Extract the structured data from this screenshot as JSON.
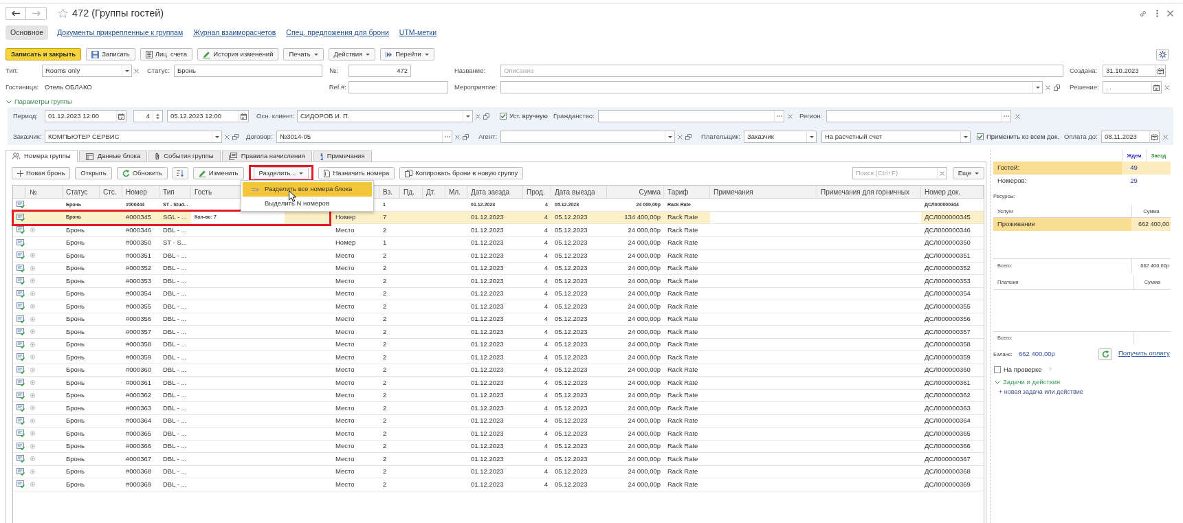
{
  "window": {
    "title": "472 (Группы гостей)",
    "favorite": false
  },
  "nav_buttons": [
    {
      "disabled": false
    },
    {
      "disabled": true
    }
  ],
  "section_tabs": [
    {
      "label": "Основное",
      "selected": true
    },
    {
      "label": "Документы прикрепленные к группам",
      "selected": false
    },
    {
      "label": "Журнал взаиморасчетов",
      "selected": false
    },
    {
      "label": "Спец. предложения для брони",
      "selected": false
    },
    {
      "label": "UTM-метки",
      "selected": false
    }
  ],
  "toolbar": [
    {
      "label": "Записать и закрыть",
      "kind": "primary",
      "menu": false
    },
    {
      "label": "Записать",
      "kind": "plain",
      "menu": false
    },
    {
      "label": "Лиц. счета",
      "kind": "plain",
      "menu": false
    },
    {
      "label": "История изменений",
      "kind": "plain",
      "menu": false
    },
    {
      "label": "Печать",
      "kind": "plain",
      "menu": true
    },
    {
      "label": "Действия",
      "kind": "plain",
      "menu": true
    },
    {
      "label": "Перейти",
      "kind": "plain",
      "menu": true
    }
  ],
  "header": {
    "type": {
      "label": "Тип:",
      "value": "Rooms only"
    },
    "status": {
      "label": "Статус:",
      "value": "Бронь"
    },
    "number": {
      "label": "№:",
      "value": "472"
    },
    "name": {
      "label": "Название:",
      "placeholder": "Описание"
    },
    "created": {
      "label": "Создана:",
      "value": "31.10.2023"
    },
    "hotel": {
      "label": "Гостиница:",
      "value": "Отель ОБЛАКО"
    },
    "ref": {
      "label": "Ref.#:"
    },
    "event": {
      "label": "Мероприятие:"
    },
    "decision": {
      "label": "Решение:",
      "value": ". ."
    }
  },
  "group_params": {
    "title": "Параметры группы",
    "expanded": true,
    "period": {
      "label": "Период:",
      "start": "01.12.2023 12:00",
      "nights": "4",
      "end": "05.12.2023 12:00"
    },
    "main_client": {
      "label": "Осн. клиент:",
      "value": "СИДОРОВ И. П."
    },
    "manual": {
      "label": "Уст. вручную",
      "checked": true
    },
    "citizenship": {
      "label": "Гражданство:"
    },
    "region": {
      "label": "Регион:"
    },
    "customer": {
      "label": "Заказчик:",
      "value": "КОМПЬЮТЕР СЕРВИС"
    },
    "contract": {
      "label": "Договор:",
      "value": "№3014-05"
    },
    "agent": {
      "label": "Агент:"
    },
    "payer": {
      "label": "Плательщик:",
      "value": "Заказчик"
    },
    "payment_method": {
      "value": "На расчетный счет"
    },
    "apply_all": {
      "label": "Применить ко всем док.",
      "checked": true
    },
    "pay_by": {
      "label": "Оплата до:",
      "value": "08.11.2023"
    }
  },
  "content_tabs": [
    {
      "label": "Номера группы",
      "selected": true
    },
    {
      "label": "Данные блока",
      "selected": false
    },
    {
      "label": "События группы",
      "selected": false
    },
    {
      "label": "Правила начисления",
      "selected": false
    },
    {
      "label": "Примечания",
      "selected": false
    }
  ],
  "table_toolbar": [
    {
      "label": "Новая бронь",
      "kind": "text",
      "menu": false,
      "framed": false
    },
    {
      "label": "Открыть",
      "kind": "text",
      "menu": false,
      "framed": false
    },
    {
      "label": "Обновить",
      "kind": "text",
      "menu": false,
      "framed": false
    },
    {
      "kind": "icon",
      "menu": false,
      "framed": false
    },
    {
      "label": "Изменить",
      "kind": "text",
      "menu": false,
      "framed": false
    },
    {
      "label": "Разделить...",
      "kind": "text",
      "menu": true,
      "framed": true
    },
    {
      "label": "Назначить номера",
      "kind": "text",
      "menu": false,
      "framed": false
    },
    {
      "label": "Копировать брони в новую группу",
      "kind": "text",
      "menu": false,
      "framed": false
    }
  ],
  "search": {
    "placeholder": "Поиск (Ctrl+F)"
  },
  "more_button": {
    "label": "Еще",
    "menu": true
  },
  "split_menu": {
    "items": [
      {
        "label": "Разделить все номера блока",
        "selected": true
      },
      {
        "label": "Выделить N номеров",
        "selected": false
      }
    ]
  },
  "table": {
    "columns": {
      "no": "№",
      "status": "Статус",
      "sts": "Стс.",
      "room": "Номер",
      "type": "Тип",
      "guest": "Гость",
      "adults": "Вз.",
      "teens": "Пд.",
      "kids": "Дт.",
      "infants": "Мл.",
      "arrival": "Дата заезда",
      "nights": "Прод.",
      "departure": "Дата выезда",
      "sum": "Сумма",
      "tariff": "Тариф",
      "notes": "Примечания",
      "maid_notes": "Примечания для горничных",
      "doc": "Номер док."
    },
    "rows": [
      {
        "kind": "summary",
        "selected": false,
        "framed": false,
        "expandable": false,
        "status": "Бронь",
        "room": "#000344",
        "type": "ST - Stud...",
        "adults": "1",
        "arrival": "01.12.2023",
        "nights": "4",
        "departure": "05.12.2023",
        "sum": "24 000,00р",
        "tariff": "Rack Rate",
        "doc": "ДСЛ000000344"
      },
      {
        "kind": "block",
        "selected": true,
        "framed": true,
        "expandable": false,
        "status": "Бронь",
        "room": "#000345",
        "type": "SGL - ...",
        "guest": "Кол-во: 7",
        "column_8": "Номер",
        "adults": "7",
        "arrival": "01.12.2023",
        "nights": "4",
        "departure": "05.12.2023",
        "sum": "134 400,00р",
        "tariff": "Rack Rate",
        "doc": "ДСЛ000000345"
      },
      {
        "kind": "room",
        "selected": false,
        "framed": false,
        "expandable": true,
        "status": "Бронь",
        "room": "#000346",
        "type": "DBL - ...",
        "column_8": "Место",
        "adults": "2",
        "arrival": "01.12.2023",
        "nights": "4",
        "departure": "05.12.2023",
        "sum": "24 000,00р",
        "tariff": "Rack Rate",
        "doc": "ДСЛ000000346"
      },
      {
        "kind": "room",
        "selected": false,
        "framed": false,
        "expandable": false,
        "status": "Бронь",
        "room": "#000350",
        "type": "ST - S...",
        "column_8": "Номер",
        "adults": "1",
        "arrival": "01.12.2023",
        "nights": "4",
        "departure": "05.12.2023",
        "sum": "24 000,00р",
        "tariff": "Rack Rate",
        "doc": "ДСЛ000000350"
      },
      {
        "kind": "room",
        "selected": false,
        "framed": false,
        "expandable": true,
        "status": "Бронь",
        "room": "#000351",
        "type": "DBL - ...",
        "column_8": "Место",
        "adults": "2",
        "arrival": "01.12.2023",
        "nights": "4",
        "departure": "05.12.2023",
        "sum": "24 000,00р",
        "tariff": "Rack Rate",
        "doc": "ДСЛ000000351"
      },
      {
        "kind": "room",
        "selected": false,
        "framed": false,
        "expandable": true,
        "status": "Бронь",
        "room": "#000352",
        "type": "DBL - ...",
        "column_8": "Место",
        "adults": "2",
        "arrival": "01.12.2023",
        "nights": "4",
        "departure": "05.12.2023",
        "sum": "24 000,00р",
        "tariff": "Rack Rate",
        "doc": "ДСЛ000000352"
      },
      {
        "kind": "room",
        "selected": false,
        "framed": false,
        "expandable": true,
        "status": "Бронь",
        "room": "#000353",
        "type": "DBL - ...",
        "column_8": "Место",
        "adults": "2",
        "arrival": "01.12.2023",
        "nights": "4",
        "departure": "05.12.2023",
        "sum": "24 000,00р",
        "tariff": "Rack Rate",
        "doc": "ДСЛ000000353"
      },
      {
        "kind": "room",
        "selected": false,
        "framed": false,
        "expandable": true,
        "status": "Бронь",
        "room": "#000354",
        "type": "DBL - ...",
        "column_8": "Место",
        "adults": "2",
        "arrival": "01.12.2023",
        "nights": "4",
        "departure": "05.12.2023",
        "sum": "24 000,00р",
        "tariff": "Rack Rate",
        "doc": "ДСЛ000000354"
      },
      {
        "kind": "room",
        "selected": false,
        "framed": false,
        "expandable": true,
        "status": "Бронь",
        "room": "#000355",
        "type": "DBL - ...",
        "column_8": "Место",
        "adults": "2",
        "arrival": "01.12.2023",
        "nights": "4",
        "departure": "05.12.2023",
        "sum": "24 000,00р",
        "tariff": "Rack Rate",
        "doc": "ДСЛ000000355"
      },
      {
        "kind": "room",
        "selected": false,
        "framed": false,
        "expandable": true,
        "status": "Бронь",
        "room": "#000356",
        "type": "DBL - ...",
        "column_8": "Место",
        "adults": "2",
        "arrival": "01.12.2023",
        "nights": "4",
        "departure": "05.12.2023",
        "sum": "24 000,00р",
        "tariff": "Rack Rate",
        "doc": "ДСЛ000000356"
      },
      {
        "kind": "room",
        "selected": false,
        "framed": false,
        "expandable": true,
        "status": "Бронь",
        "room": "#000357",
        "type": "DBL - ...",
        "column_8": "Место",
        "adults": "2",
        "arrival": "01.12.2023",
        "nights": "4",
        "departure": "05.12.2023",
        "sum": "24 000,00р",
        "tariff": "Rack Rate",
        "doc": "ДСЛ000000357"
      },
      {
        "kind": "room",
        "selected": false,
        "framed": false,
        "expandable": true,
        "status": "Бронь",
        "room": "#000358",
        "type": "DBL - ...",
        "column_8": "Место",
        "adults": "2",
        "arrival": "01.12.2023",
        "nights": "4",
        "departure": "05.12.2023",
        "sum": "24 000,00р",
        "tariff": "Rack Rate",
        "doc": "ДСЛ000000358"
      },
      {
        "kind": "room",
        "selected": false,
        "framed": false,
        "expandable": true,
        "status": "Бронь",
        "room": "#000359",
        "type": "DBL - ...",
        "column_8": "Место",
        "adults": "2",
        "arrival": "01.12.2023",
        "nights": "4",
        "departure": "05.12.2023",
        "sum": "24 000,00р",
        "tariff": "Rack Rate",
        "doc": "ДСЛ000000359"
      },
      {
        "kind": "room",
        "selected": false,
        "framed": false,
        "expandable": true,
        "status": "Бронь",
        "room": "#000360",
        "type": "DBL - ...",
        "column_8": "Место",
        "adults": "2",
        "arrival": "01.12.2023",
        "nights": "4",
        "departure": "05.12.2023",
        "sum": "24 000,00р",
        "tariff": "Rack Rate",
        "doc": "ДСЛ000000360"
      },
      {
        "kind": "room",
        "selected": false,
        "framed": false,
        "expandable": true,
        "status": "Бронь",
        "room": "#000361",
        "type": "DBL - ...",
        "column_8": "Место",
        "adults": "2",
        "arrival": "01.12.2023",
        "nights": "4",
        "departure": "05.12.2023",
        "sum": "24 000,00р",
        "tariff": "Rack Rate",
        "doc": "ДСЛ000000361"
      },
      {
        "kind": "room",
        "selected": false,
        "framed": false,
        "expandable": true,
        "status": "Бронь",
        "room": "#000362",
        "type": "DBL - ...",
        "column_8": "Место",
        "adults": "2",
        "arrival": "01.12.2023",
        "nights": "4",
        "departure": "05.12.2023",
        "sum": "24 000,00р",
        "tariff": "Rack Rate",
        "doc": "ДСЛ000000362"
      },
      {
        "kind": "room",
        "selected": false,
        "framed": false,
        "expandable": true,
        "status": "Бронь",
        "room": "#000363",
        "type": "DBL - ...",
        "column_8": "Место",
        "adults": "2",
        "arrival": "01.12.2023",
        "nights": "4",
        "departure": "05.12.2023",
        "sum": "24 000,00р",
        "tariff": "Rack Rate",
        "doc": "ДСЛ000000363"
      },
      {
        "kind": "room",
        "selected": false,
        "framed": false,
        "expandable": true,
        "status": "Бронь",
        "room": "#000364",
        "type": "DBL - ...",
        "column_8": "Место",
        "adults": "2",
        "arrival": "01.12.2023",
        "nights": "4",
        "departure": "05.12.2023",
        "sum": "24 000,00р",
        "tariff": "Rack Rate",
        "doc": "ДСЛ000000364"
      },
      {
        "kind": "room",
        "selected": false,
        "framed": false,
        "expandable": true,
        "status": "Бронь",
        "room": "#000365",
        "type": "DBL - ...",
        "column_8": "Место",
        "adults": "2",
        "arrival": "01.12.2023",
        "nights": "4",
        "departure": "05.12.2023",
        "sum": "24 000,00р",
        "tariff": "Rack Rate",
        "doc": "ДСЛ000000365"
      },
      {
        "kind": "room",
        "selected": false,
        "framed": false,
        "expandable": true,
        "status": "Бронь",
        "room": "#000366",
        "type": "DBL - ...",
        "column_8": "Место",
        "adults": "2",
        "arrival": "01.12.2023",
        "nights": "4",
        "departure": "05.12.2023",
        "sum": "24 000,00р",
        "tariff": "Rack Rate",
        "doc": "ДСЛ000000366"
      },
      {
        "kind": "room",
        "selected": false,
        "framed": false,
        "expandable": true,
        "status": "Бронь",
        "room": "#000367",
        "type": "DBL - ...",
        "column_8": "Место",
        "adults": "2",
        "arrival": "01.12.2023",
        "nights": "4",
        "departure": "05.12.2023",
        "sum": "24 000,00р",
        "tariff": "Rack Rate",
        "doc": "ДСЛ000000367"
      },
      {
        "kind": "room",
        "selected": false,
        "framed": false,
        "expandable": true,
        "status": "Бронь",
        "room": "#000368",
        "type": "DBL - ...",
        "column_8": "Место",
        "adults": "2",
        "arrival": "01.12.2023",
        "nights": "4",
        "departure": "05.12.2023",
        "sum": "24 000,00р",
        "tariff": "Rack Rate",
        "doc": "ДСЛ000000368"
      },
      {
        "kind": "room",
        "selected": false,
        "framed": false,
        "expandable": true,
        "status": "Бронь",
        "room": "#000369",
        "type": "DBL - ...",
        "column_8": "Место",
        "adults": "2",
        "arrival": "01.12.2023",
        "nights": "4",
        "departure": "05.12.2023",
        "sum": "24 000,00р",
        "tariff": "Rack Rate",
        "doc": "ДСЛ000000369"
      }
    ]
  },
  "side_panel": {
    "summary": {
      "columns": [
        {
          "label": "Ждем",
          "color": "#2626c4"
        },
        {
          "label": "Заезд",
          "color": "#2e8c3a"
        }
      ],
      "rows": [
        {
          "label": "Гостей:",
          "values": [
            "49"
          ],
          "selected": true
        },
        {
          "label": "Номеров:",
          "values": [
            "29"
          ],
          "selected": false
        }
      ]
    },
    "resources": {
      "title": "Ресурсы:",
      "columns": [
        "Услуги",
        "Сумма"
      ],
      "rows": [
        {
          "service": "Проживание",
          "sum": "662 400,00",
          "selected": true
        }
      ],
      "total_label": "Всего:",
      "total": "662 400,00р"
    },
    "payments": {
      "columns": [
        "Платежи",
        "Сумма"
      ],
      "total_label": "Всего:"
    },
    "balance": {
      "label": "Баланс:",
      "value": "662 400,00р"
    },
    "get_payment": "Получить оплату",
    "on_review": {
      "label": "На проверке",
      "checked": false,
      "help": "?"
    },
    "tasks": {
      "title": "Задачи и действия",
      "expanded": true,
      "new_item": "+ новая задача или действие"
    }
  }
}
